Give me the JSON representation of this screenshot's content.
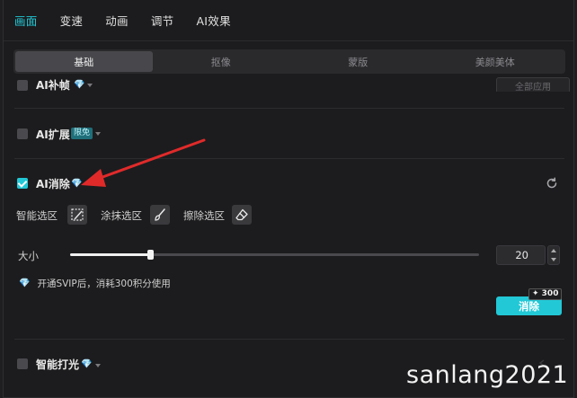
{
  "top_tabs": [
    {
      "label": "画面",
      "active": true
    },
    {
      "label": "变速",
      "active": false
    },
    {
      "label": "动画",
      "active": false
    },
    {
      "label": "调节",
      "active": false
    },
    {
      "label": "AI效果",
      "active": false
    }
  ],
  "sub_tabs": [
    {
      "label": "基础",
      "active": true
    },
    {
      "label": "抠像",
      "active": false
    },
    {
      "label": "蒙版",
      "active": false
    },
    {
      "label": "美颜美体",
      "active": false
    }
  ],
  "sections": {
    "ai_zhen": {
      "label": "AI补帧",
      "partial_button": "全部应用"
    },
    "ai_expand": {
      "label": "AI扩展",
      "badge": "限免"
    },
    "ai_erase": {
      "label": "AI消除",
      "checked": true,
      "tools": [
        "智能选区",
        "涂抹选区",
        "擦除选区"
      ],
      "size_label": "大小",
      "size_value": "20",
      "size_fraction": 0.196,
      "info_text": "开通SVIP后，消耗300积分使用",
      "erase_button": "消除",
      "cost_tag": "✦ 300"
    },
    "smart_light": {
      "label": "智能打光"
    }
  },
  "watermark": "sanlang2021",
  "colors": {
    "accent": "#22c8d6",
    "arrow": "#e02a2a",
    "gem": "#5fd8ee"
  }
}
